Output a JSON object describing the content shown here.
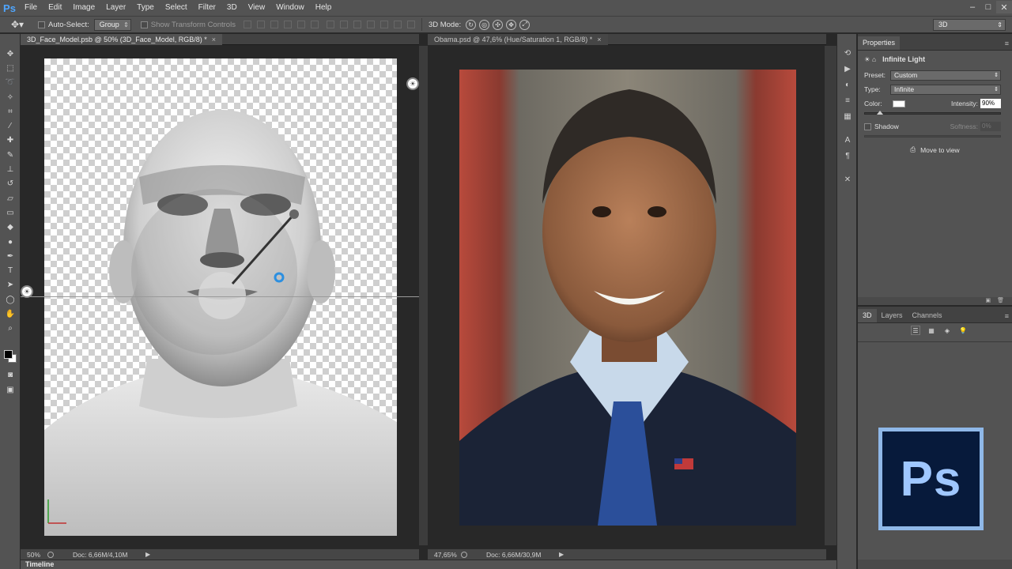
{
  "app": {
    "logo": "Ps"
  },
  "menu": [
    "File",
    "Edit",
    "Image",
    "Layer",
    "Type",
    "Select",
    "Filter",
    "3D",
    "View",
    "Window",
    "Help"
  ],
  "window_controls": {
    "minimize": "–",
    "maximize": "□",
    "close": "✕"
  },
  "options_bar": {
    "auto_select_label": "Auto-Select:",
    "auto_select_value": "Group",
    "transform_controls_label": "Show Transform Controls",
    "mode_label": "3D Mode:",
    "workspace": "3D"
  },
  "documents": [
    {
      "tab_title": "3D_Face_Model.psb @ 50% (3D_Face_Model, RGB/8) *",
      "zoom": "50%",
      "doc_size": "Doc: 6,66M/4,10M"
    },
    {
      "tab_title": "Obama.psd @ 47,6% (Hue/Saturation 1, RGB/8) *",
      "zoom": "47,65%",
      "doc_size": "Doc: 6,66M/30,9M"
    }
  ],
  "properties": {
    "tab": "Properties",
    "light_name": "Infinite Light",
    "preset_label": "Preset:",
    "preset_value": "Custom",
    "type_label": "Type:",
    "type_value": "Infinite",
    "color_label": "Color:",
    "light_color": "#ffffff",
    "intensity_label": "Intensity:",
    "intensity_value": "90%",
    "intensity_level": 0.09,
    "shadow_label": "Shadow",
    "softness_label": "Softness:",
    "softness_value": "0%",
    "move_to_view": "Move to view"
  },
  "lower_panel": {
    "tabs": [
      "3D",
      "Layers",
      "Channels"
    ]
  },
  "timeline": {
    "label": "Timeline"
  },
  "colors": {
    "accent_blue": "#4fa6ff",
    "panel": "#535353",
    "background": "#282828"
  }
}
